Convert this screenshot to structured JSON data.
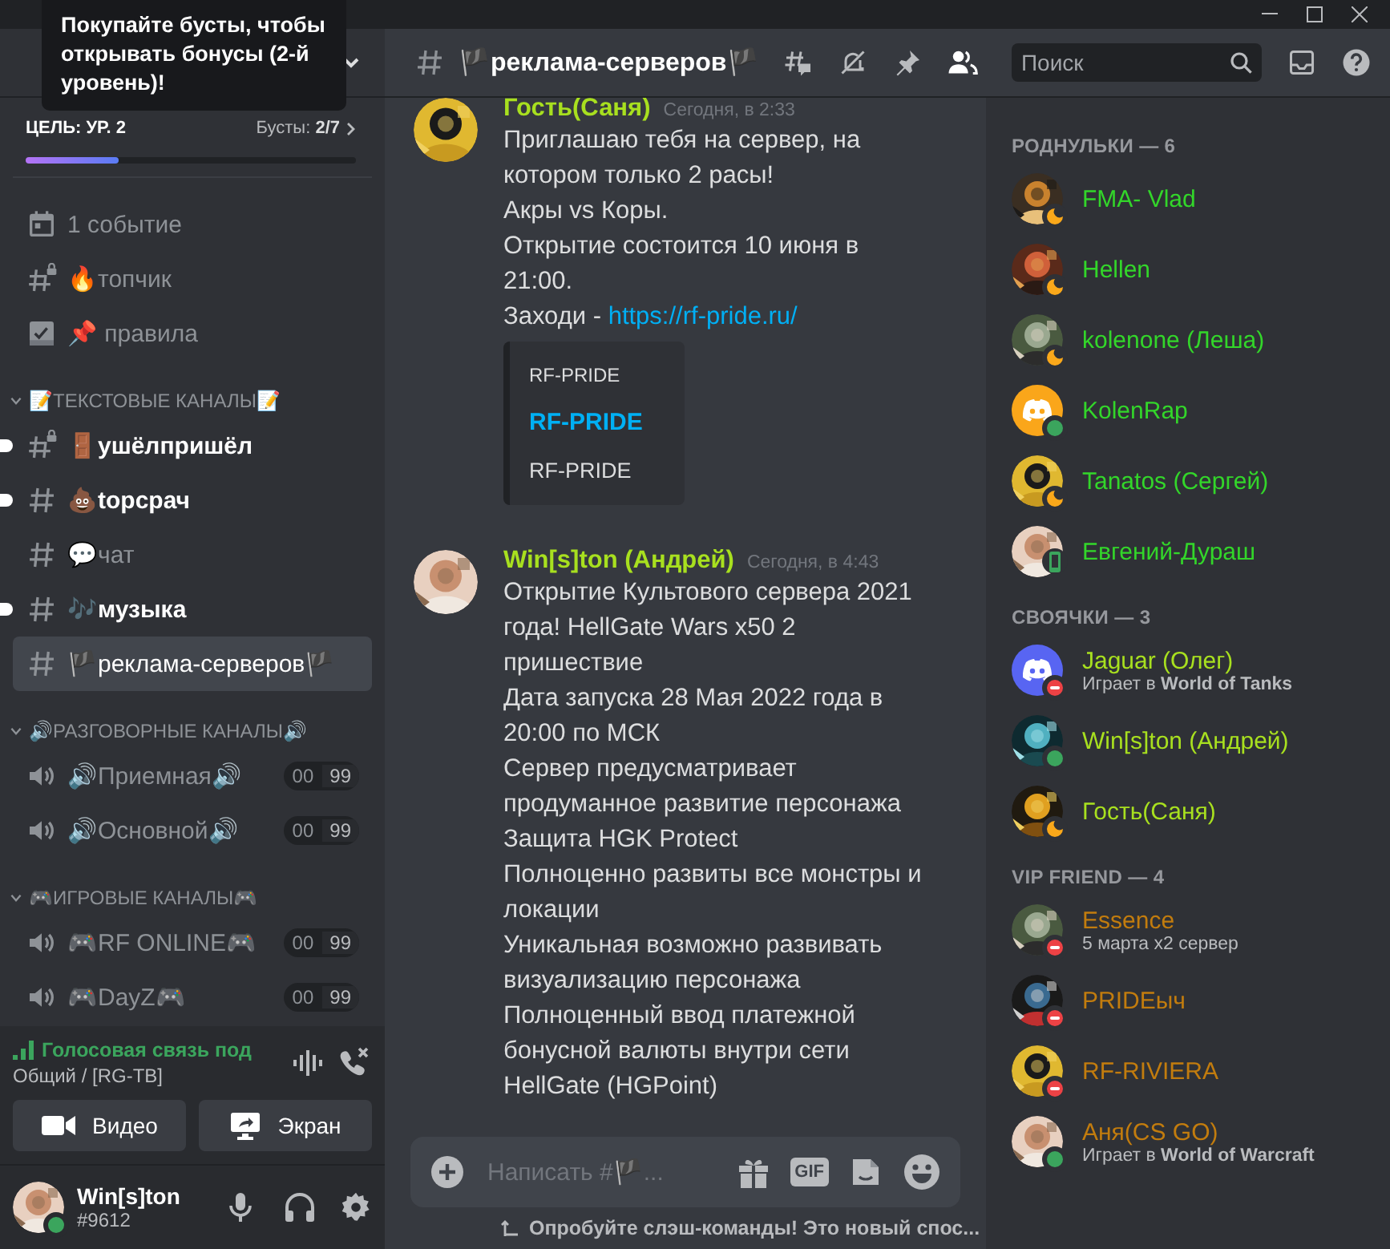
{
  "tooltip": {
    "text": "Покупайте бусты, чтобы открывать бонусы (2-й уровень)!"
  },
  "boost": {
    "goal": "ЦЕЛЬ: УР. 2",
    "boosts_label": "Бусты:",
    "boosts_count": "2/7",
    "level": 0.28
  },
  "sidebar": {
    "top_items": [
      {
        "kind": "event",
        "label": "1 событие",
        "locked": false
      },
      {
        "kind": "text",
        "label": "🔥топчик",
        "locked": true
      },
      {
        "kind": "rules",
        "label": "📌 правила",
        "locked": false
      }
    ],
    "categories": [
      {
        "title": "📝ТЕКСТОВЫЕ КАНАЛЫ📝",
        "expanded": true,
        "channels": [
          {
            "kind": "text",
            "name": "🚪ушёлпришёл",
            "locked": true,
            "unread": true,
            "selected": false
          },
          {
            "kind": "text",
            "name": "💩topcрач",
            "locked": false,
            "unread": true,
            "selected": false
          },
          {
            "kind": "text",
            "name": "💬чат",
            "locked": false,
            "unread": false,
            "selected": false
          },
          {
            "kind": "text",
            "name": "🎶музыка",
            "locked": false,
            "unread": true,
            "selected": false
          },
          {
            "kind": "text",
            "name": "🏴реклама-серверов🏴",
            "locked": false,
            "unread": false,
            "selected": true
          }
        ]
      },
      {
        "title": "🔊РАЗГОВОРНЫЕ КАНАЛЫ🔊",
        "expanded": true,
        "channels": [
          {
            "kind": "voice",
            "name": "🔊Приемная🔊",
            "users": "00",
            "limit": "99",
            "selected": false
          },
          {
            "kind": "voice",
            "name": "🔊Основной🔊",
            "users": "00",
            "limit": "99",
            "selected": false
          }
        ]
      },
      {
        "title": "🎮ИГРОВЫЕ КАНАЛЫ🎮",
        "expanded": true,
        "channels": [
          {
            "kind": "voice",
            "name": "🎮RF ONLINE🎮",
            "users": "00",
            "limit": "99",
            "selected": false
          },
          {
            "kind": "voice",
            "name": "🎮DayZ🎮",
            "users": "00",
            "limit": "99",
            "selected": false
          }
        ]
      }
    ]
  },
  "voice_status": {
    "title": "Голосовая связь под",
    "channel": "Общий / [RG-TB]"
  },
  "media_buttons": [
    {
      "kind": "video",
      "label": "Видео"
    },
    {
      "kind": "screen",
      "label": "Экран"
    }
  ],
  "user": {
    "name": "Win[s]ton",
    "tag": "#9612",
    "status": {
      "kind": "online"
    }
  },
  "header": {
    "channel": "🏴реклама-серверов🏴",
    "search_placeholder": "Поиск"
  },
  "messages": [
    {
      "author": "Гость(Саня)",
      "color": "#a8e01f",
      "time": "Сегодня, в 2:33",
      "lines": [
        {
          "text": "Приглашаю тебя на сервер, на котором только 2 расы!"
        },
        {
          "text": "Акры vs Коры."
        },
        {
          "text": "Открытие состоится 10 июня в 21:00."
        },
        {
          "text": "Заходи - ",
          "link": "https://rf-pride.ru/"
        }
      ],
      "embed": {
        "provider": "RF-PRIDE",
        "title": "RF-PRIDE",
        "description": "RF-PRIDE"
      }
    },
    {
      "author": "Win[s]ton (Андрей)",
      "color": "#a8e01f",
      "time": "Сегодня, в 4:43",
      "lines": [
        {
          "text": "Открытие Культового сервера 2021 года! HellGate Wars x50 2 пришествие"
        },
        {
          "text": "Дата запуска 28 Мая 2022 года в 20:00 по МСК"
        },
        {
          "text": "Сервер предусматривает продуманное развитие персонажа"
        },
        {
          "text": "Защита HGK Protect"
        },
        {
          "text": "Полноценно развиты все монстры и локации"
        },
        {
          "text": "Уникальная возможно развивать визуализацию персонажа"
        },
        {
          "text": "Полноценный ввод платежной бонусной валюты внутри сети HellGate (HGPoint)"
        }
      ]
    }
  ],
  "composer": {
    "placeholder": "Написать #🏴...",
    "gif_label": "GIF",
    "hint": "Опробуйте слэш-команды! Это новый спос..."
  },
  "member_groups": [
    {
      "title": "РОДНУЛЬКИ — 6",
      "members": [
        {
          "name": "FMA- Vlad",
          "color": "#33d62a",
          "status": {
            "kind": "idle"
          }
        },
        {
          "name": "Hellen",
          "color": "#33d62a",
          "status": {
            "kind": "idle"
          }
        },
        {
          "name": "kolenone (Леша)",
          "color": "#33d62a",
          "status": {
            "kind": "idle"
          }
        },
        {
          "name": "KolenRap",
          "color": "#33d62a",
          "status": {
            "kind": "online"
          },
          "avatar": {
            "kind": "default",
            "color": "#faa61a"
          }
        },
        {
          "name": "Tanatos (Сергей)",
          "color": "#33d62a",
          "status": {
            "kind": "idle"
          }
        },
        {
          "name": "Евгений-Дураш",
          "color": "#33d62a",
          "status": {
            "kind": "mobile"
          }
        }
      ]
    },
    {
      "title": "СВОЯЧКИ — 3",
      "members": [
        {
          "name": "Jaguar (Олег)",
          "color": "#a8e01f",
          "status": {
            "kind": "dnd"
          },
          "activity": "Играет в **World of Tanks**",
          "avatar": {
            "kind": "default",
            "color": "#5865f2"
          }
        },
        {
          "name": "Win[s]ton (Андрей)",
          "color": "#a8e01f",
          "status": {
            "kind": "online"
          }
        },
        {
          "name": "Гость(Саня)",
          "color": "#a8e01f",
          "status": {
            "kind": "idle"
          }
        }
      ]
    },
    {
      "title": "VIP FRIEND — 4",
      "members": [
        {
          "name": "Essence",
          "color": "#c27c0e",
          "status": {
            "kind": "dnd"
          },
          "activity": "5 марта x2 сервер"
        },
        {
          "name": "PRIDEыч",
          "color": "#c27c0e",
          "status": {
            "kind": "dnd"
          }
        },
        {
          "name": "RF-RIVIERA",
          "color": "#c27c0e",
          "status": {
            "kind": "dnd"
          }
        },
        {
          "name": "Аня(CS GO)",
          "color": "#c27c0e",
          "status": {
            "kind": "online"
          },
          "activity": "Играет в **World of Warcraft**"
        }
      ]
    }
  ]
}
